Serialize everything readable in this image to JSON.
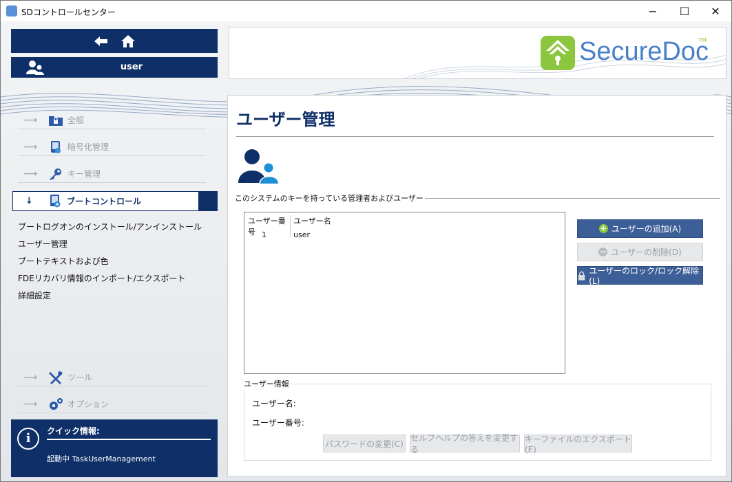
{
  "window": {
    "title": "SDコントロールセンター",
    "minimize": "−",
    "maximize": "☐",
    "close": "✕"
  },
  "header": {
    "user_label": "user"
  },
  "logo": {
    "brand": "SecureDoc",
    "trademark": "TM"
  },
  "sidebar": {
    "items": [
      {
        "label": "全般",
        "icon": "lock-folder-icon"
      },
      {
        "label": "暗号化管理",
        "icon": "encryption-icon"
      },
      {
        "label": "キー管理",
        "icon": "key-icon"
      },
      {
        "label": "ブートコントロール",
        "icon": "boot-control-icon"
      }
    ],
    "sublinks": [
      "ブートログオンのインストール/アンインストール",
      "ユーザー管理",
      "ブートテキストおよび色",
      "FDEリカバリ情報のインポート/エクスポート",
      "詳細設定"
    ],
    "bottom_items": [
      {
        "label": "ツール",
        "icon": "tools-icon"
      },
      {
        "label": "オプション",
        "icon": "gears-icon"
      }
    ]
  },
  "quick_info": {
    "title": "クイック情報:",
    "text": "起動中 TaskUserManagement"
  },
  "main": {
    "title": "ユーザー管理",
    "section_title": "このシステムのキーを持っている管理者およびユーザー",
    "table": {
      "columns": [
        "ユーザー番号",
        "ユーザー名"
      ],
      "rows": [
        {
          "number": "1",
          "name": "user"
        }
      ]
    },
    "buttons": {
      "add": "ユーザーの追加(A)",
      "delete": "ユーザーの削除(D)",
      "lock": "ユーザーのロック/ロック解除(L)"
    },
    "user_info": {
      "title": "ユーザー情報",
      "name_label": "ユーザー名:",
      "number_label": "ユーザー番号:",
      "change_password": "パスワードの変更(C)",
      "change_selfhelp": "セルフヘルプの答えを変更する",
      "export_keyfile": "キーファイルのエクスポート(E)"
    }
  },
  "colors": {
    "navy": "#0e2f67",
    "button_blue": "#3d5f98",
    "logo_green": "#8cc63f",
    "logo_blue": "#4a80c8"
  }
}
